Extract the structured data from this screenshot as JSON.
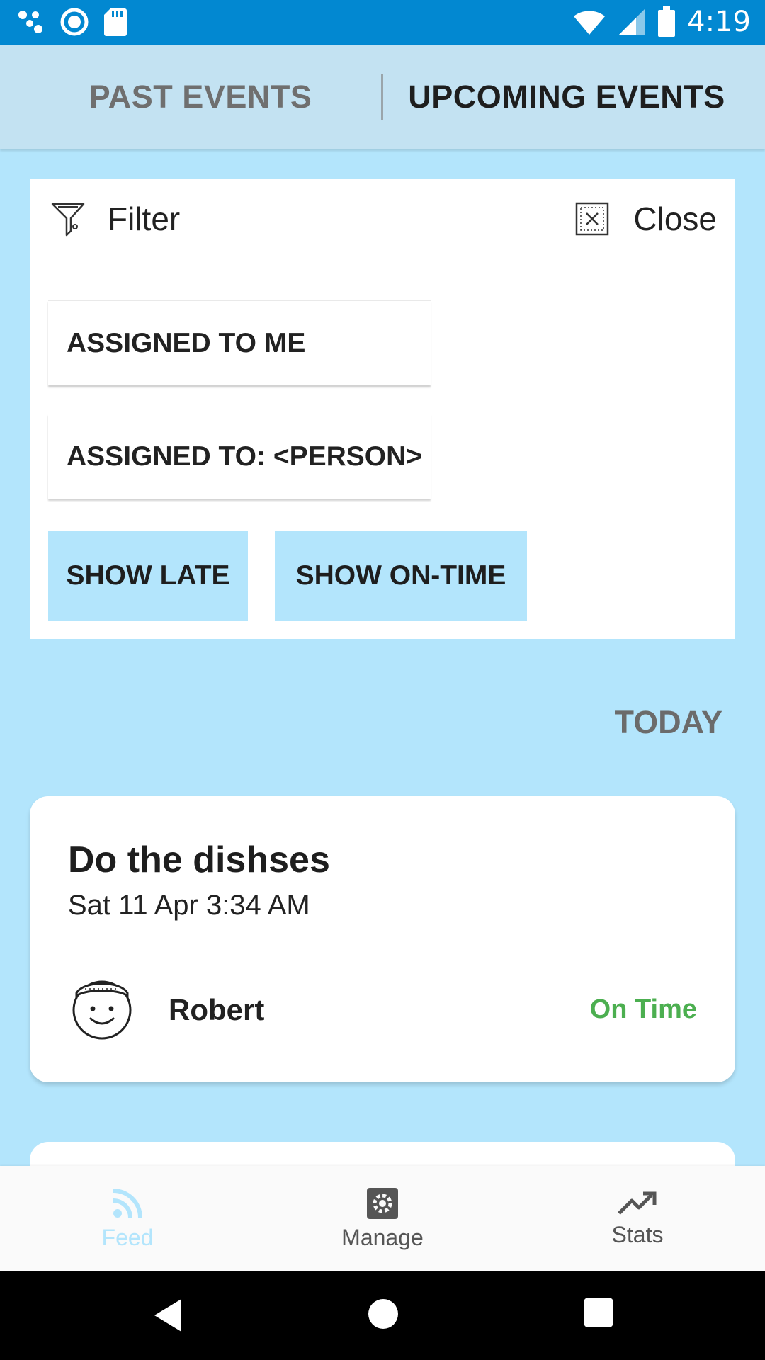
{
  "status_bar": {
    "time": "4:19",
    "icons": [
      "dots-icon",
      "record-icon",
      "sd-card-icon",
      "wifi-icon",
      "signal-icon",
      "battery-icon"
    ]
  },
  "tabs": {
    "past": "PAST EVENTS",
    "upcoming": "UPCOMING EVENTS",
    "active": "upcoming"
  },
  "filter": {
    "title": "Filter",
    "close_label": "Close",
    "options": [
      "ASSIGNED TO ME",
      "ASSIGNED TO: <PERSON>"
    ],
    "chips": [
      "SHOW LATE",
      "SHOW ON-TIME"
    ]
  },
  "section": {
    "heading": "TODAY"
  },
  "events": [
    {
      "title": "Do the dishses",
      "date": "Sat 11 Apr 3:34 AM",
      "assignee": "Robert",
      "status": "On Time",
      "status_color": "#4caf50"
    }
  ],
  "bottom_nav": {
    "items": [
      {
        "label": "Feed",
        "icon": "rss-feed-icon",
        "active": true
      },
      {
        "label": "Manage",
        "icon": "gear-icon",
        "active": false
      },
      {
        "label": "Stats",
        "icon": "trending-up-icon",
        "active": false
      }
    ],
    "active_color": "#b3e5fc",
    "inactive_color": "#555555"
  },
  "colors": {
    "status_bar": "#0288d1",
    "background": "#b3e5fc",
    "tab_bar": "#c3e2f2"
  }
}
